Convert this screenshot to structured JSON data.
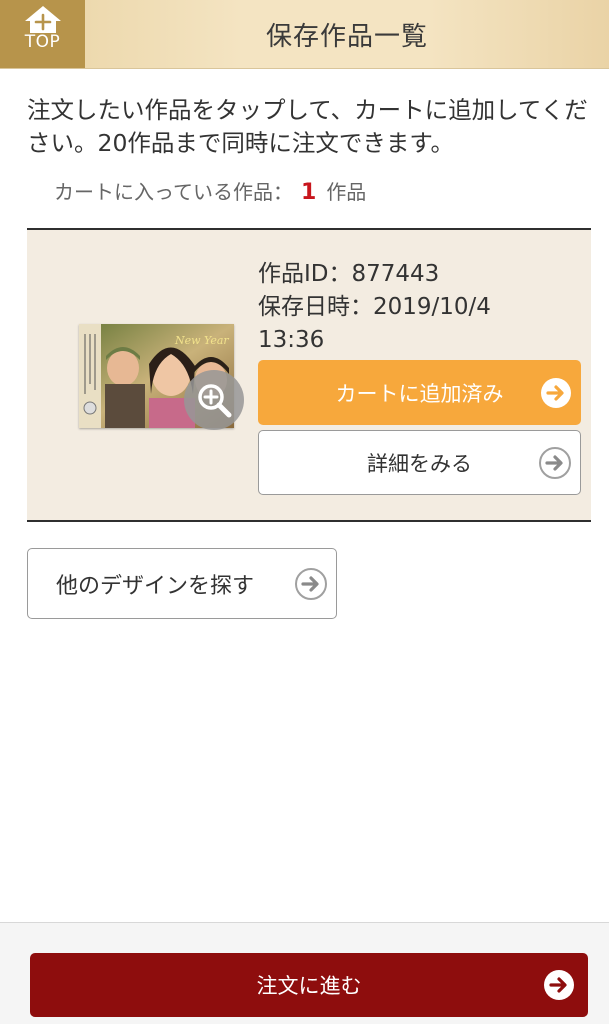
{
  "header": {
    "top_label": "TOP",
    "title": "保存作品一覧"
  },
  "intro": {
    "text": "注文したい作品をタップして、カートに追加してください。20作品まで同時に注文できます。"
  },
  "cart": {
    "prefix": "カートに入っている作品：",
    "count": "1",
    "suffix": "作品"
  },
  "item": {
    "id_line": "作品ID：877443",
    "date_line": "保存日時：2019/10/4",
    "time_line": "13:36",
    "added_label": "カートに追加済み",
    "detail_label": "詳細をみる"
  },
  "other_design_label": "他のデザインを探す",
  "order_label": "注文に進む",
  "colors": {
    "header_bg": "#f4e4c2",
    "top_button": "#b7944b",
    "added_button": "#f7a83c",
    "order_button": "#8e0d0d",
    "count_red": "#c8161d",
    "panel_bg": "#f3ece1"
  }
}
